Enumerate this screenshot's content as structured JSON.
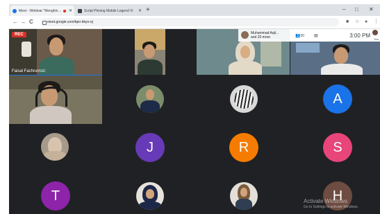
{
  "browser": {
    "tabs": [
      {
        "title": "Meet - Webinar \"Menghinda",
        "favicon_color": "#1a73e8",
        "recording": true
      },
      {
        "title": "Script Phising Mobile Legend Vi",
        "favicon_color": "#3c4043",
        "recording": false
      }
    ],
    "new_tab": "+",
    "window_controls": [
      "–",
      "□",
      "✕"
    ],
    "nav": {
      "back": "←",
      "forward": "→",
      "reload": "C"
    },
    "url": "meet.google.com/bpo-bkyo-ej"
  },
  "meet": {
    "rec_label": "REC",
    "presenter_name": "Faisal Fachrurrozi",
    "attendees_label": "Muhammad Aqli...",
    "attendees_more": "and 20 more",
    "people_count": "20",
    "clock": "3:00 PM",
    "you_label": "You",
    "avatars": [
      {
        "letter": "A",
        "color": "#1a73e8"
      },
      {
        "letter": "J",
        "color": "#673ab7"
      },
      {
        "letter": "R",
        "color": "#f57c00"
      },
      {
        "letter": "S",
        "color": "#e8457a"
      },
      {
        "letter": "T",
        "color": "#8e24aa"
      },
      {
        "letter": "H",
        "color": "#6d4c41"
      }
    ],
    "watermark_line1": "Activate Windows",
    "watermark_line2": "Go to Settings to activate Windows."
  }
}
